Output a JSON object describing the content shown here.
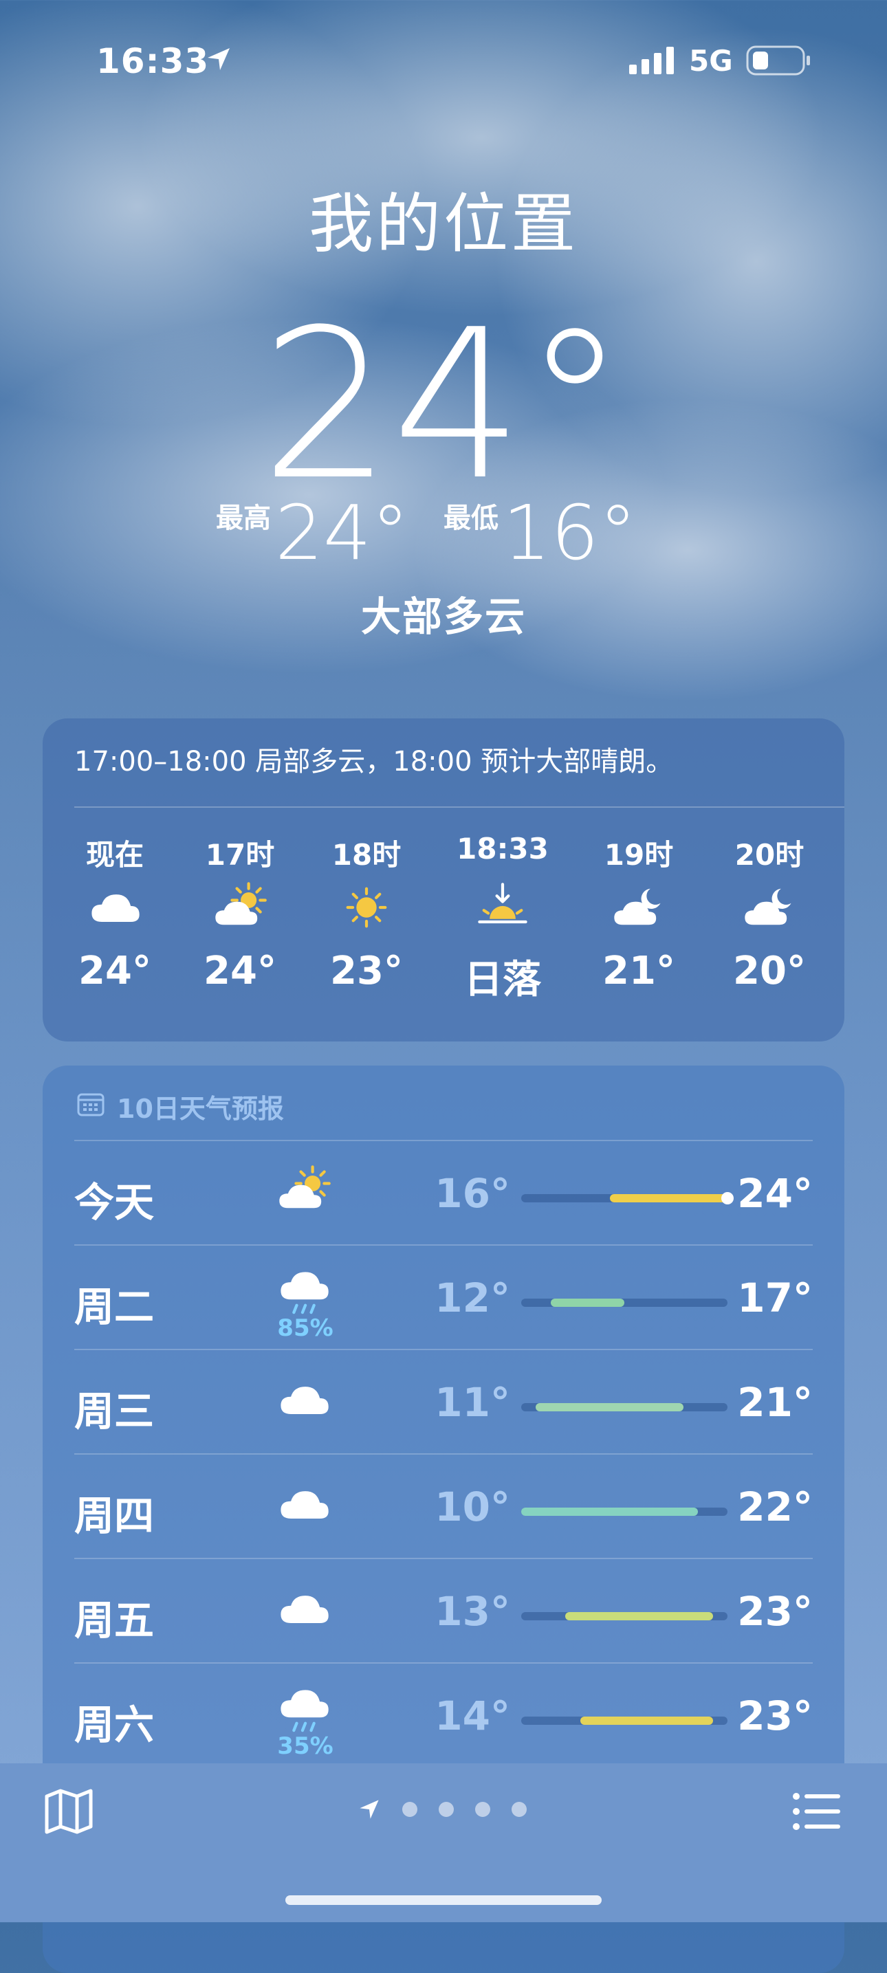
{
  "status": {
    "time": "16:33",
    "network": "5G"
  },
  "location": {
    "city": "我的位置",
    "temperature": "24°",
    "high_label": "最高",
    "high": "24°",
    "low_label": "最低",
    "low": "16°",
    "condition": "大部多云"
  },
  "hourly": {
    "summary": "17:00–18:00 局部多云，18:00 预计大部晴朗。",
    "items": [
      {
        "label": "现在",
        "icon": "cloud-icon",
        "temp": "24°"
      },
      {
        "label": "17时",
        "icon": "partly-sunny-icon",
        "temp": "24°"
      },
      {
        "label": "18时",
        "icon": "sun-icon",
        "temp": "23°"
      },
      {
        "label": "18:33",
        "icon": "sunset-icon",
        "temp": "日落"
      },
      {
        "label": "19时",
        "icon": "partly-cloudy-night-icon",
        "temp": "21°"
      },
      {
        "label": "20时",
        "icon": "partly-cloudy-night-icon",
        "temp": "20°"
      }
    ]
  },
  "daily": {
    "title": "10日天气预报",
    "range_min": 10,
    "range_max": 24,
    "days": [
      {
        "label": "今天",
        "icon": "partly-sunny-icon",
        "precip": "",
        "low": "16°",
        "high": "24°",
        "low_v": 16,
        "high_v": 24,
        "current_v": 24,
        "color": "#f0cf4a"
      },
      {
        "label": "周二",
        "icon": "rain-icon",
        "precip": "85%",
        "low": "12°",
        "high": "17°",
        "low_v": 12,
        "high_v": 17,
        "color": "#8fd4a8"
      },
      {
        "label": "周三",
        "icon": "cloud-icon",
        "precip": "",
        "low": "11°",
        "high": "21°",
        "low_v": 11,
        "high_v": 21,
        "color": "#9fd6b0"
      },
      {
        "label": "周四",
        "icon": "cloud-icon",
        "precip": "",
        "low": "10°",
        "high": "22°",
        "low_v": 10,
        "high_v": 22,
        "color": "#86d3c0"
      },
      {
        "label": "周五",
        "icon": "cloud-icon",
        "precip": "",
        "low": "13°",
        "high": "23°",
        "low_v": 13,
        "high_v": 23,
        "color": "#c9dc7a"
      },
      {
        "label": "周六",
        "icon": "rain-icon",
        "precip": "35%",
        "low": "14°",
        "high": "23°",
        "low_v": 14,
        "high_v": 23,
        "color": "#e3d35a"
      }
    ]
  },
  "pager": {
    "pages": 4
  }
}
